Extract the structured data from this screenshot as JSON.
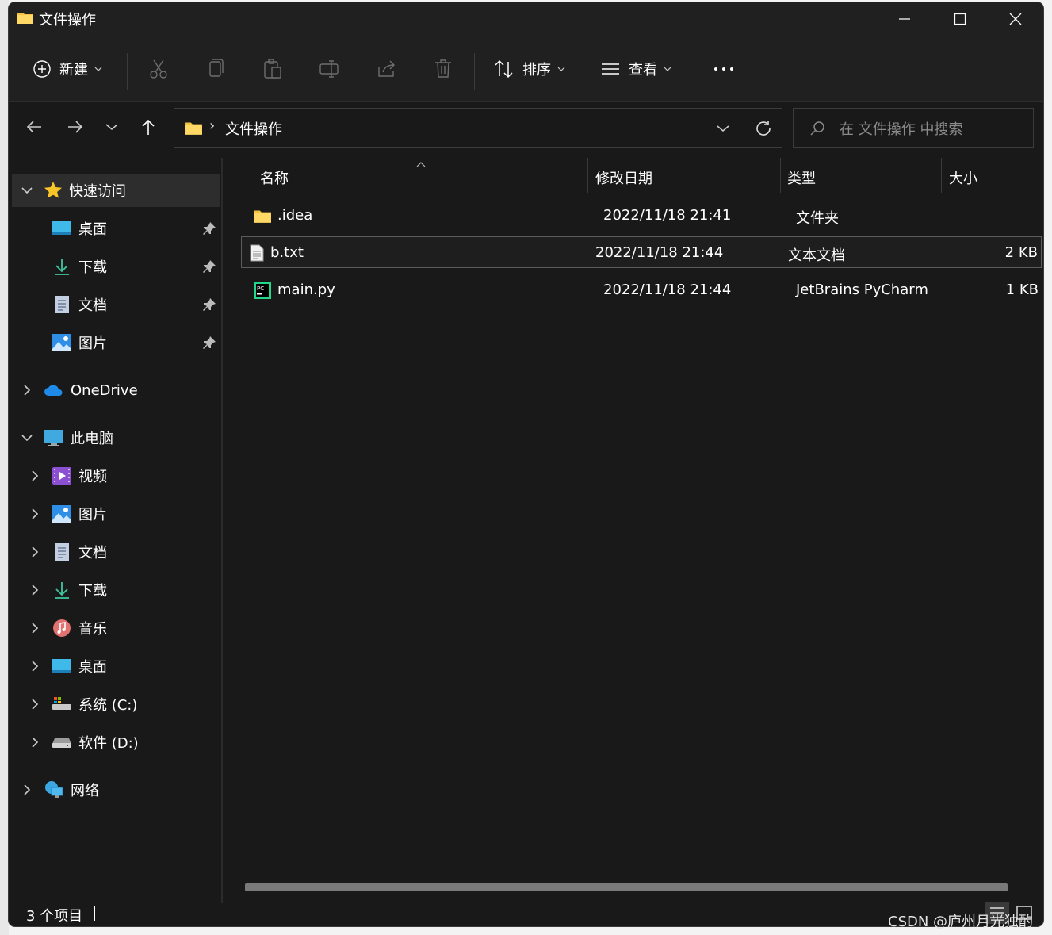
{
  "window": {
    "title": "文件操作"
  },
  "toolbar": {
    "new_label": "新建",
    "sort_label": "排序",
    "view_label": "查看",
    "more_label": "..."
  },
  "address": {
    "path": "文件操作",
    "separator": "›"
  },
  "search": {
    "placeholder": "在 文件操作 中搜索"
  },
  "sidebar": {
    "quick_access": "快速访问",
    "quick_items": [
      "桌面",
      "下载",
      "文档",
      "图片"
    ],
    "onedrive": "OneDrive",
    "this_pc": "此电脑",
    "pc_items": [
      "视频",
      "图片",
      "文档",
      "下载",
      "音乐",
      "桌面",
      "系统 (C:)",
      "软件 (D:)"
    ],
    "network": "网络"
  },
  "columns": {
    "name": "名称",
    "modified": "修改日期",
    "type": "类型",
    "size": "大小"
  },
  "files": [
    {
      "name": ".idea",
      "modified": "2022/11/18 21:41",
      "type": "文件夹",
      "size": ""
    },
    {
      "name": "b.txt",
      "modified": "2022/11/18 21:44",
      "type": "文本文档",
      "size": "2 KB"
    },
    {
      "name": "main.py",
      "modified": "2022/11/18 21:44",
      "type": "JetBrains PyCharm",
      "size": "1 KB"
    }
  ],
  "status": {
    "item_count": "3 个项目"
  },
  "watermark": "CSDN @庐州月光独酌",
  "colors": {
    "window_bg": "#191919",
    "chrome_bg": "#202020",
    "selection": "#2d2d2d",
    "folder": "#f5c342",
    "accent": "#0078d4"
  }
}
